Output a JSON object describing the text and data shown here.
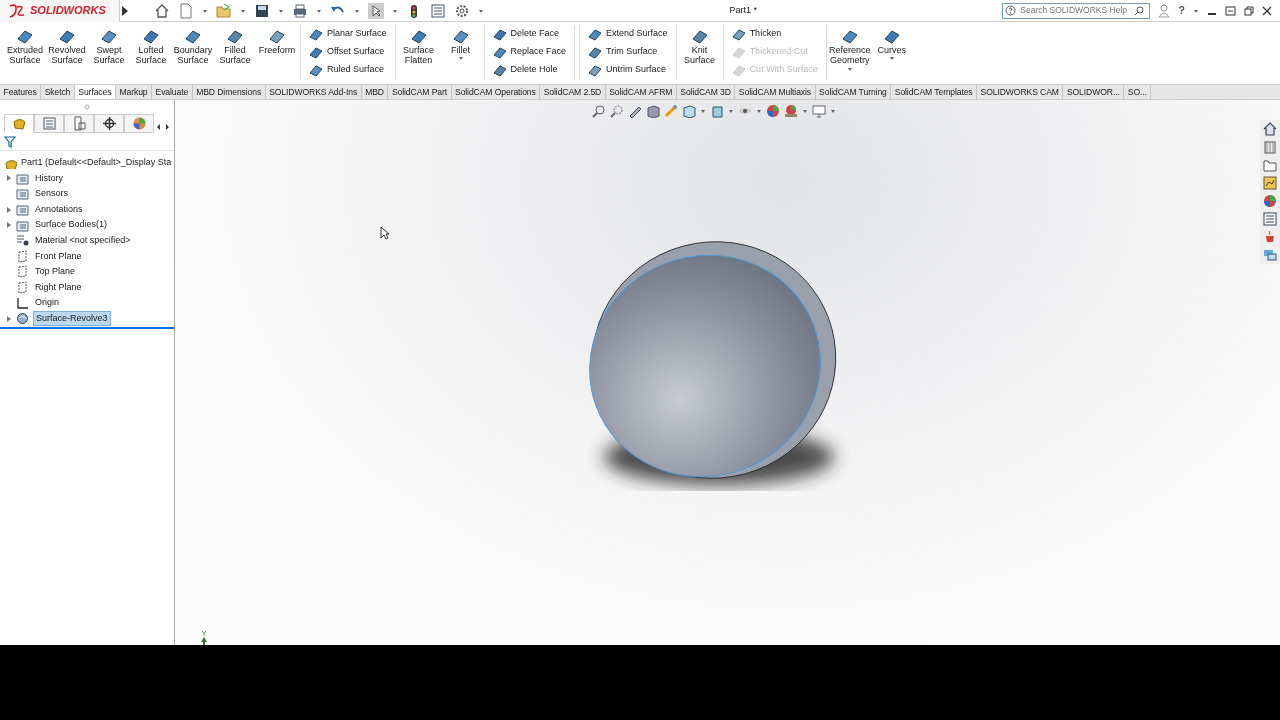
{
  "title_bar": {
    "brand": "SOLIDWORKS",
    "document_title": "Part1 *",
    "search": {
      "placeholder": "Search SOLIDWORKS Help"
    },
    "help": "?"
  },
  "ribbon": [
    {
      "kind": "large",
      "label": "Extruded Surface",
      "dropdown": false
    },
    {
      "kind": "large",
      "label": "Revolved Surface",
      "dropdown": false
    },
    {
      "kind": "large",
      "label": "Swept Surface",
      "dropdown": false
    },
    {
      "kind": "large",
      "label": "Lofted Surface",
      "dropdown": false
    },
    {
      "kind": "large",
      "label": "Boundary Surface",
      "dropdown": false
    },
    {
      "kind": "large",
      "label": "Filled Surface",
      "dropdown": false
    },
    {
      "kind": "large",
      "label": "Freeform",
      "dropdown": false
    },
    {
      "kind": "stack",
      "items": [
        {
          "label": "Planar Surface",
          "disabled": false
        },
        {
          "label": "Offset Surface",
          "disabled": false
        },
        {
          "label": "Ruled Surface",
          "disabled": false
        }
      ]
    },
    {
      "kind": "large",
      "label": "Surface Flatten",
      "dropdown": false
    },
    {
      "kind": "large",
      "label": "Fillet",
      "dropdown": true
    },
    {
      "kind": "stack",
      "items": [
        {
          "label": "Delete Face",
          "disabled": false
        },
        {
          "label": "Replace Face",
          "disabled": false
        },
        {
          "label": "Delete Hole",
          "disabled": false
        }
      ]
    },
    {
      "kind": "stack",
      "items": [
        {
          "label": "Extend Surface",
          "disabled": false
        },
        {
          "label": "Trim Surface",
          "disabled": false
        },
        {
          "label": "Untrim Surface",
          "disabled": false
        }
      ]
    },
    {
      "kind": "large",
      "label": "Knit Surface",
      "dropdown": false
    },
    {
      "kind": "stack",
      "items": [
        {
          "label": "Thicken",
          "disabled": false
        },
        {
          "label": "Thickened Cut",
          "disabled": true
        },
        {
          "label": "Cut With Surface",
          "disabled": true
        }
      ]
    },
    {
      "kind": "large",
      "label": "Reference Geometry",
      "dropdown": true
    },
    {
      "kind": "large",
      "label": "Curves",
      "dropdown": true
    }
  ],
  "command_tabs": [
    {
      "label": "Features",
      "selected": false
    },
    {
      "label": "Sketch",
      "selected": false
    },
    {
      "label": "Surfaces",
      "selected": true
    },
    {
      "label": "Markup",
      "selected": false
    },
    {
      "label": "Evaluate",
      "selected": false
    },
    {
      "label": "MBD Dimensions",
      "selected": false
    },
    {
      "label": "SOLIDWORKS Add-Ins",
      "selected": false
    },
    {
      "label": "MBD",
      "selected": false
    },
    {
      "label": "SolidCAM Part",
      "selected": false
    },
    {
      "label": "SolidCAM Operations",
      "selected": false
    },
    {
      "label": "SolidCAM 2.5D",
      "selected": false
    },
    {
      "label": "SolidCAM AFRM",
      "selected": false
    },
    {
      "label": "SolidCAM 3D",
      "selected": false
    },
    {
      "label": "SolidCAM Multiaxis",
      "selected": false
    },
    {
      "label": "SolidCAM Turning",
      "selected": false
    },
    {
      "label": "SolidCAM Templates",
      "selected": false
    },
    {
      "label": "SOLIDWORKS CAM",
      "selected": false
    },
    {
      "label": "SOLIDWOR...",
      "selected": false
    },
    {
      "label": "SO...",
      "selected": false
    }
  ],
  "panel_tabs": [
    {
      "selected": true
    },
    {
      "selected": false
    },
    {
      "selected": false
    },
    {
      "selected": false
    },
    {
      "selected": false
    }
  ],
  "feature_tree": {
    "root": "Part1  (Default<<Default>_Display Sta",
    "items": [
      {
        "kind": "folder",
        "label": "History",
        "expandable": true,
        "selected": false
      },
      {
        "kind": "folder",
        "label": "Sensors",
        "expandable": false,
        "selected": false
      },
      {
        "kind": "folder",
        "label": "Annotations",
        "expandable": true,
        "selected": false
      },
      {
        "kind": "folder",
        "label": "Surface Bodies(1)",
        "expandable": true,
        "selected": false
      },
      {
        "kind": "material",
        "label": "Material <not specified>",
        "expandable": false,
        "selected": false
      },
      {
        "kind": "plane",
        "label": "Front Plane",
        "expandable": false,
        "selected": false
      },
      {
        "kind": "plane",
        "label": "Top Plane",
        "expandable": false,
        "selected": false
      },
      {
        "kind": "plane",
        "label": "Right Plane",
        "expandable": false,
        "selected": false
      },
      {
        "kind": "origin",
        "label": "Origin",
        "expandable": false,
        "selected": false
      },
      {
        "kind": "feature",
        "label": "Surface-Revolve3",
        "expandable": true,
        "selected": true
      }
    ]
  },
  "viewport": {
    "triad_label": "Y"
  }
}
